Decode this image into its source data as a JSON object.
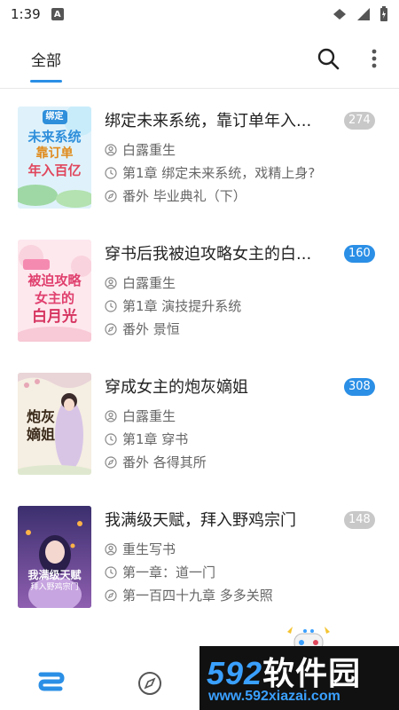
{
  "status_bar": {
    "time": "1:39",
    "notif_letter": "A"
  },
  "header": {
    "tab_all": "全部"
  },
  "books": [
    {
      "title": "绑定未来系统，靠订单年入...",
      "badge": "274",
      "badge_color": "#c8c8c8",
      "author": "白露重生",
      "latest_read": "第1章 绑定未来系统，戏精上身?",
      "latest_update": "番外 毕业典礼（下）",
      "cover": {
        "lines": [
          "绑定",
          "未来系统",
          "靠订单",
          "年入百亿"
        ],
        "bg": "#e8f6ff"
      }
    },
    {
      "title": "穿书后我被迫攻略女主的白...",
      "badge": "160",
      "badge_color": "#2b8fe6",
      "author": "白露重生",
      "latest_read": "第1章 演技提升系统",
      "latest_update": "番外 景恒",
      "cover": {
        "lines": [
          "被迫攻略",
          "女主的",
          "白月光"
        ],
        "bg": "#ffe9ef"
      }
    },
    {
      "title": "穿成女主的炮灰嫡姐",
      "badge": "308",
      "badge_color": "#2b8fe6",
      "author": "白露重生",
      "latest_read": "第1章 穿书",
      "latest_update": "番外 各得其所",
      "cover": {
        "lines": [
          "炮灰",
          "嫡姐"
        ],
        "bg": "#f6efe4"
      }
    },
    {
      "title": "我满级天赋，拜入野鸡宗门",
      "badge": "148",
      "badge_color": "#c8c8c8",
      "author": "重生写书",
      "latest_read": "第一章：道一门",
      "latest_update": "第一百四十九章 多多关照",
      "cover": {
        "lines": [
          "我满级天赋",
          "拜入野鸡宗门"
        ],
        "bg": "#4a3a7a"
      }
    }
  ],
  "watermark": {
    "big_num": "592",
    "big_text": "软件园",
    "url": "www.592xiazai.com"
  }
}
